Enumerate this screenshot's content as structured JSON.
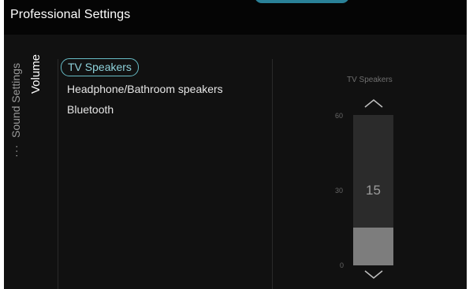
{
  "header": {
    "title": "Professional Settings"
  },
  "breadcrumb": {
    "ellipsis": "···",
    "parent": "Sound Settings",
    "current": "Volume"
  },
  "menu": {
    "items": [
      {
        "label": "TV Speakers",
        "selected": true
      },
      {
        "label": "Headphone/Bathroom speakers",
        "selected": false
      },
      {
        "label": "Bluetooth",
        "selected": false
      }
    ]
  },
  "volume_slider": {
    "title": "TV Speakers",
    "value": "15",
    "level": 15,
    "max": 60,
    "ticks": {
      "max": "60",
      "mid": "30",
      "min": "0"
    },
    "up_icon": "chevron-up-icon",
    "down_icon": "chevron-down-icon"
  },
  "colors": {
    "background": "#111111",
    "accent": "#67bcc6",
    "track": "#2b2b2b",
    "fill": "#7d7d7d"
  }
}
